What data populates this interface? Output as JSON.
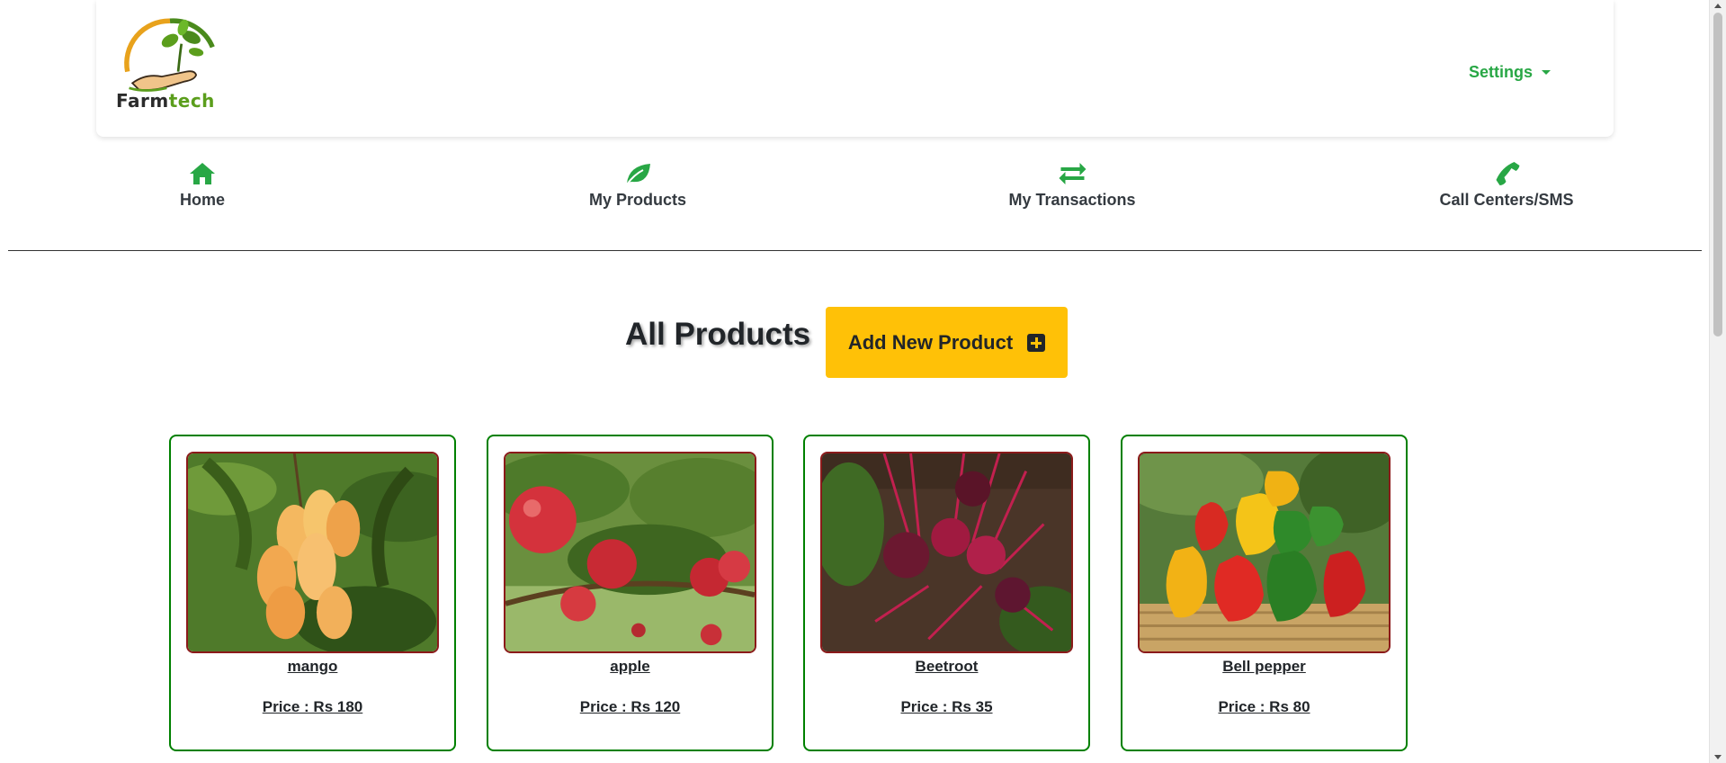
{
  "header": {
    "logo_text_farm": "Farm",
    "logo_text_tech": "tech",
    "settings_label": "Settings"
  },
  "nav": {
    "items": [
      {
        "label": "Home",
        "icon": "home-icon"
      },
      {
        "label": "My Products",
        "icon": "leaf-icon"
      },
      {
        "label": "My Transactions",
        "icon": "exchange-icon"
      },
      {
        "label": "Call Centers/SMS",
        "icon": "phone-icon"
      }
    ]
  },
  "main": {
    "title": "All Products",
    "add_button_label": "Add New Product",
    "products": [
      {
        "name": "mango",
        "price": "Price : Rs 180"
      },
      {
        "name": "apple",
        "price": "Price : Rs 120"
      },
      {
        "name": "Beetroot",
        "price": "Price : Rs 35"
      },
      {
        "name": "Bell pepper",
        "price": "Price : Rs 80"
      }
    ]
  },
  "colors": {
    "brand_green": "#28a745",
    "accent_yellow": "#ffc107",
    "card_border": "#008000",
    "image_border": "#8b1a1a"
  }
}
